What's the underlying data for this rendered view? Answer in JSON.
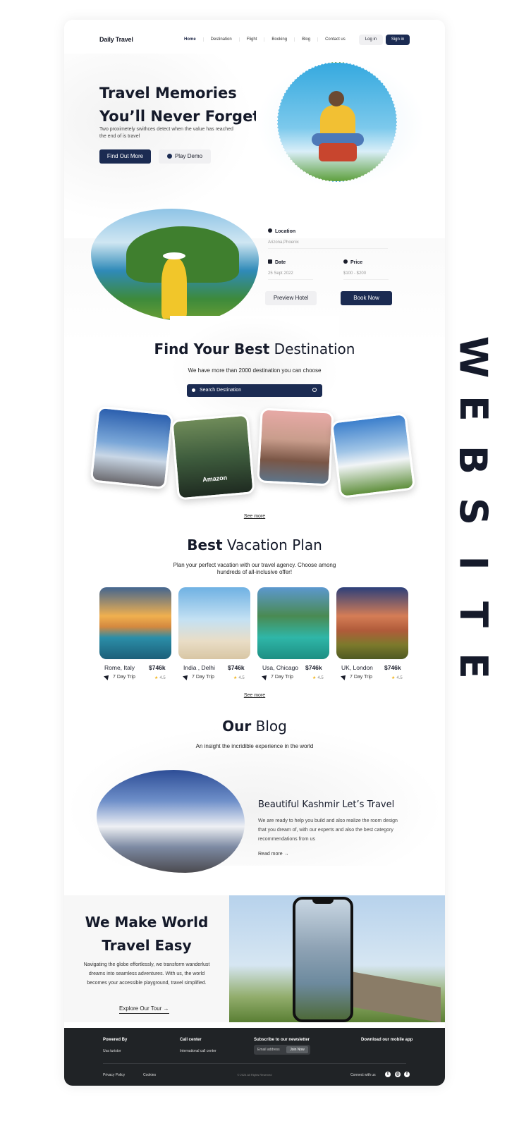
{
  "side_word": [
    "W",
    "E",
    "B",
    "S",
    "I",
    "T",
    "E"
  ],
  "nav": {
    "logo": "Daily Travel",
    "links": [
      "Home",
      "Destination",
      "Flight",
      "Booking",
      "Blog",
      "Contact us"
    ],
    "login": "Log in",
    "signin": "Sign in"
  },
  "hero": {
    "title_line1": "Travel Memories",
    "title_line2": "You’ll Never Forget",
    "subtitle": "Two proximetely swithces detect when the value has reached the end of is travel",
    "cta_primary": "Find Out More",
    "cta_secondary": "Play Demo"
  },
  "booking": {
    "location_label": "Location",
    "location_value": "Arizona,Phoenix",
    "date_label": "Date",
    "date_value": "25 Sept 2022",
    "price_label": "Price",
    "price_value": "$100 - $200",
    "preview_button": "Preview Hotel",
    "book_button": "Book Now"
  },
  "destination": {
    "title_bold": "Find Your Best",
    "title_light": "Destination",
    "subtitle": "We have more than 2000 destination you can choose",
    "search_placeholder": "Search  Destination",
    "featured_label": "Amazon",
    "see_more": "See more"
  },
  "vacation": {
    "title_bold": "Best",
    "title_light": "Vacation Plan",
    "subtitle_line1": "Plan your perfect vacation with our travel agency. Choose among",
    "subtitle_line2": "hundreds of all-inclusive offer!",
    "cards": [
      {
        "city": "Rome, Italy",
        "price": "$746k",
        "trip": "7 Day Trip",
        "rating": "4.5"
      },
      {
        "city": "India , Delhi",
        "price": "$746k",
        "trip": "7 Day Trip",
        "rating": "4.5"
      },
      {
        "city": "Usa, Chicago",
        "price": "$746k",
        "trip": "7 Day Trip",
        "rating": "4.5"
      },
      {
        "city": "UK, London",
        "price": "$746k",
        "trip": "7 Day Trip",
        "rating": "4.5"
      }
    ],
    "see_more": "See more"
  },
  "blog": {
    "title_bold": "Our",
    "title_light": "Blog",
    "subtitle": "An insight the incridible experience in the world",
    "post_title": "Beautiful Kashmir Let’s Travel",
    "post_text": "We are ready to help you build and also realize the room design that you dream of, with our experts and also the best category recommendations from us",
    "read_more": "Read more →"
  },
  "promo": {
    "title_line1": "We  Make World",
    "title_line2": "Travel Easy",
    "text": "Navigating the globe effortlessly, we transform wanderlust dreams into seamless adventures. With us, the world becomes your accessible playground, travel simplified.",
    "link": "Explore Our Tour →"
  },
  "footer": {
    "powered_by": "Powered By",
    "powered_value": "Usa turistor",
    "call_center": "Call center",
    "call_value": "International call center",
    "newsletter": "Subscribe to our newsletter",
    "email_placeholder": "Email address",
    "join": "Join Now",
    "download": "Download our mobile app",
    "privacy": "Privacy Policy",
    "cookies": "Cookies",
    "copyright": "© 2024 All Rights Reserved",
    "connect": "Connect with us"
  },
  "colors": {
    "navy": "#1b2b52",
    "dark_text": "#151a2a",
    "footer_bg": "#202326",
    "star": "#f2b41b"
  }
}
